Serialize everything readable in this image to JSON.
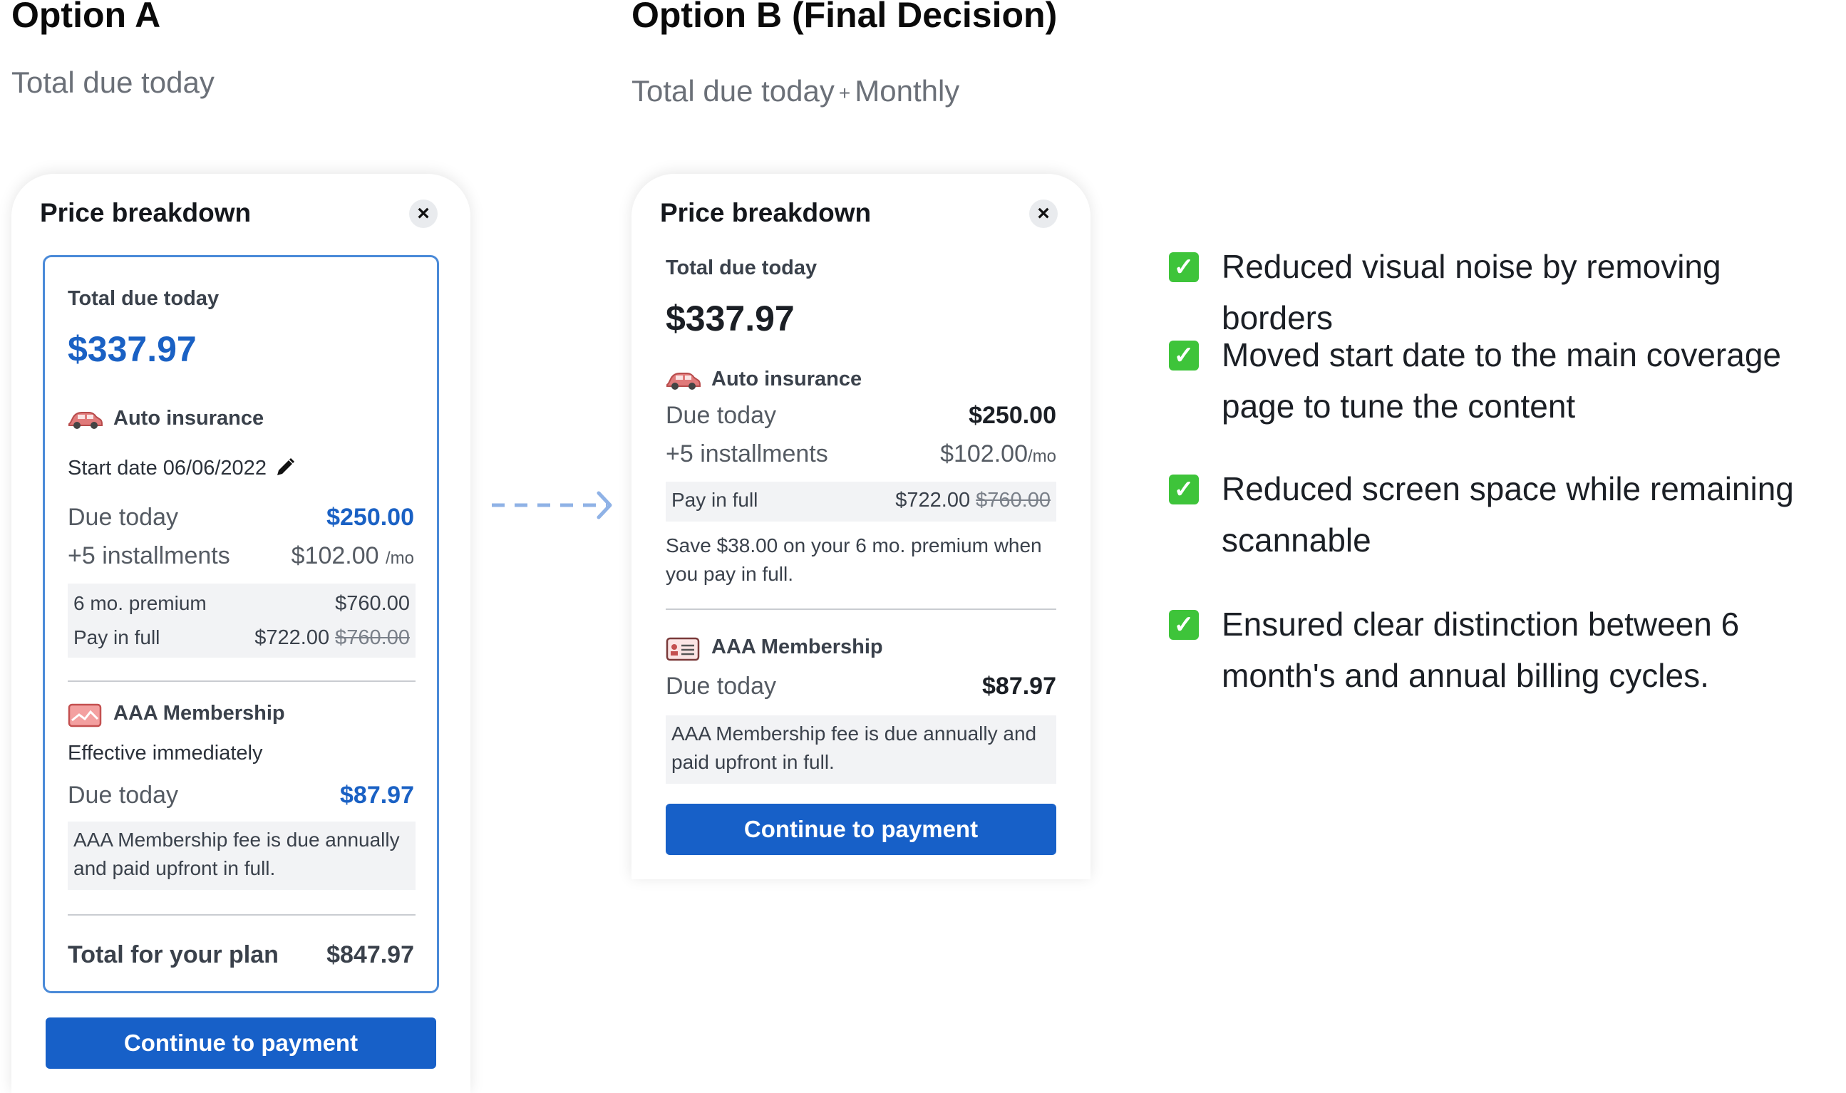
{
  "option_a": {
    "title": "Option A",
    "subtitle": "Total due today",
    "panel": {
      "title": "Price breakdown",
      "close_icon": "×",
      "total_label": "Total due today",
      "total_value": "$337.97",
      "auto": {
        "label": "Auto insurance",
        "start_date": "Start date 06/06/2022",
        "due_label": "Due today",
        "due_value": "$250.00",
        "install_label": "+5 installments",
        "install_value": "$102.00",
        "install_unit": "/mo",
        "premium_label": "6 mo. premium",
        "premium_value": "$760.00",
        "payfull_label": "Pay in full",
        "payfull_value": "$722.00",
        "payfull_old": "$760.00"
      },
      "aaa": {
        "label": "AAA Membership",
        "effective": "Effective immediately",
        "due_label": "Due today",
        "due_value": "$87.97",
        "note_line1": "AAA Membership fee is due annually",
        "note_line2": "and paid upfront in full."
      },
      "total_plan_label": "Total for your plan",
      "total_plan_value": "$847.97",
      "button": "Continue to payment"
    }
  },
  "option_b": {
    "title": "Option B (Final Decision)",
    "subtitle_a": "Total due today",
    "subtitle_plus": "+",
    "subtitle_b": "Monthly",
    "panel": {
      "title": "Price breakdown",
      "close_icon": "×",
      "total_label": "Total due today",
      "total_value": "$337.97",
      "auto": {
        "label": "Auto insurance",
        "due_label": "Due today",
        "due_value": "$250.00",
        "install_label": "+5 installments",
        "install_value": "$102.00",
        "install_unit": "/mo",
        "payfull_label": "Pay in full",
        "payfull_value": "$722.00",
        "payfull_old": "$760.00",
        "save_line1": "Save $38.00 on your 6 mo. premium when",
        "save_line2": "you pay in full."
      },
      "aaa": {
        "label": "AAA Membership",
        "due_label": "Due today",
        "due_value": "$87.97",
        "note_line1": "AAA Membership fee is due annually and",
        "note_line2": "paid upfront in full."
      },
      "button": "Continue to payment"
    }
  },
  "notes": [
    {
      "line1": "Reduced visual noise by removing borders",
      "line2": ""
    },
    {
      "line1": "Moved start date to the main coverage",
      "line2": "page to tune the content"
    },
    {
      "line1": "Reduced screen space while remaining",
      "line2": "scannable"
    },
    {
      "line1": "Ensured clear distinction between 6",
      "line2": "month's and annual billing cycles."
    }
  ],
  "check_mark": "✓",
  "colors": {
    "accent": "#1760c8",
    "blue_text": "#1a61c4",
    "check_green": "#3ec43a",
    "box_border": "#4a8ad8"
  },
  "icons": [
    "car-icon",
    "membership-card-icon",
    "pencil-icon",
    "close-icon",
    "check-icon",
    "dashed-arrow-icon"
  ]
}
